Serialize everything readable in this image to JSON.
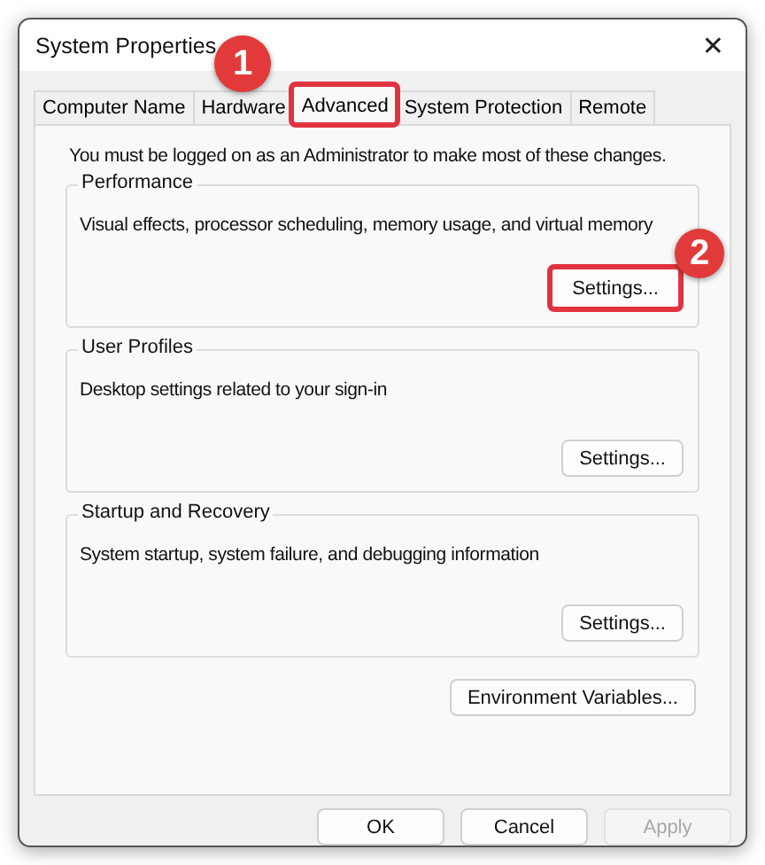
{
  "window": {
    "title": "System Properties",
    "close": "✕"
  },
  "tabs": [
    {
      "label": "Computer Name",
      "selected": false,
      "highlighted": false
    },
    {
      "label": "Hardware",
      "selected": false,
      "highlighted": false
    },
    {
      "label": "Advanced",
      "selected": true,
      "highlighted": true
    },
    {
      "label": "System Protection",
      "selected": false,
      "highlighted": false
    },
    {
      "label": "Remote",
      "selected": false,
      "highlighted": false
    }
  ],
  "notice": "You must be logged on as an Administrator to make most of these changes.",
  "groups": [
    {
      "title": "Performance",
      "description": "Visual effects, processor scheduling, memory usage, and virtual memory",
      "button": {
        "label": "Settings...",
        "highlighted": true
      }
    },
    {
      "title": "User Profiles",
      "description": "Desktop settings related to your sign-in",
      "button": {
        "label": "Settings...",
        "highlighted": false
      }
    },
    {
      "title": "Startup and Recovery",
      "description": "System startup, system failure, and debugging information",
      "button": {
        "label": "Settings...",
        "highlighted": false
      }
    }
  ],
  "environment_button": "Environment Variables...",
  "buttons": [
    {
      "label": "OK",
      "disabled": false
    },
    {
      "label": "Cancel",
      "disabled": false
    },
    {
      "label": "Apply",
      "disabled": true
    }
  ],
  "step_markers": [
    {
      "label": "1",
      "kind": "tab"
    },
    {
      "label": "2",
      "kind": "button"
    }
  ]
}
